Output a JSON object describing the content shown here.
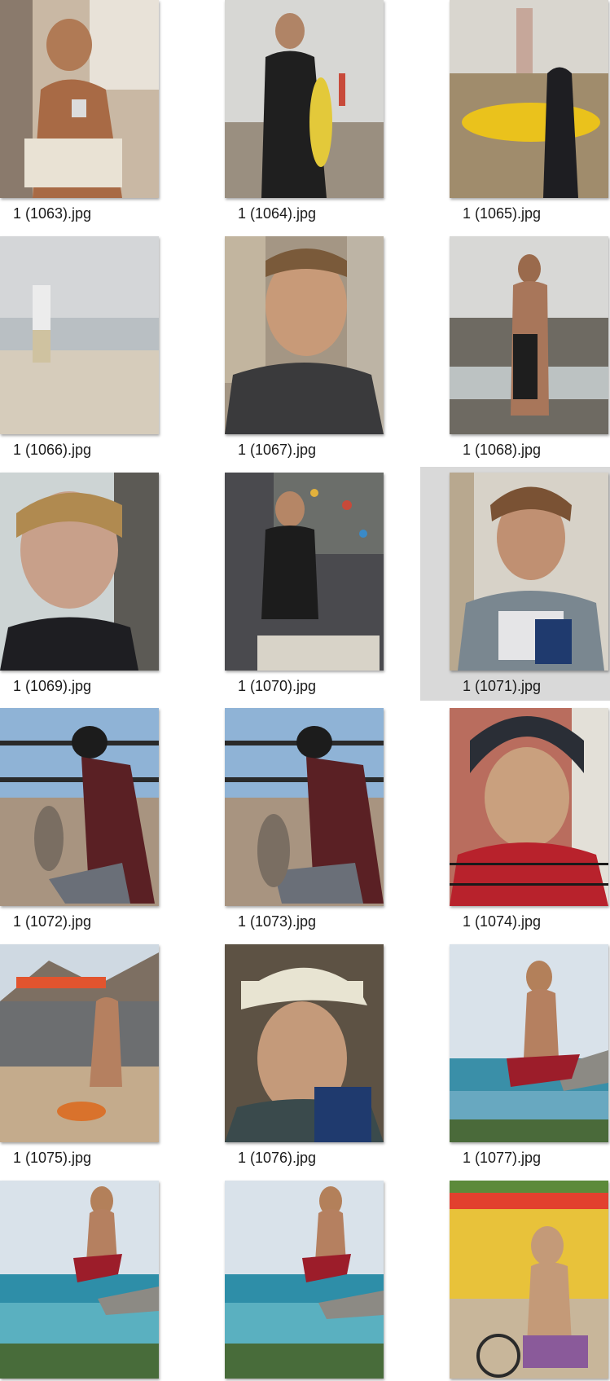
{
  "files": [
    {
      "name": "1 (1063).jpg",
      "icon": "photo-thumbnail-icon",
      "selected": false
    },
    {
      "name": "1 (1064).jpg",
      "icon": "photo-thumbnail-icon",
      "selected": false
    },
    {
      "name": "1 (1065).jpg",
      "icon": "photo-thumbnail-icon",
      "selected": false
    },
    {
      "name": "1 (1066).jpg",
      "icon": "photo-thumbnail-icon",
      "selected": false
    },
    {
      "name": "1 (1067).jpg",
      "icon": "photo-thumbnail-icon",
      "selected": false
    },
    {
      "name": "1 (1068).jpg",
      "icon": "photo-thumbnail-icon",
      "selected": false
    },
    {
      "name": "1 (1069).jpg",
      "icon": "photo-thumbnail-icon",
      "selected": false
    },
    {
      "name": "1 (1070).jpg",
      "icon": "photo-thumbnail-icon",
      "selected": false
    },
    {
      "name": "1 (1071).jpg",
      "icon": "photo-thumbnail-icon",
      "selected": true
    },
    {
      "name": "1 (1072).jpg",
      "icon": "photo-thumbnail-icon",
      "selected": false
    },
    {
      "name": "1 (1073).jpg",
      "icon": "photo-thumbnail-icon",
      "selected": false
    },
    {
      "name": "1 (1074).jpg",
      "icon": "photo-thumbnail-icon",
      "selected": false
    },
    {
      "name": "1 (1075).jpg",
      "icon": "photo-thumbnail-icon",
      "selected": false
    },
    {
      "name": "1 (1076).jpg",
      "icon": "photo-thumbnail-icon",
      "selected": false
    },
    {
      "name": "1 (1077).jpg",
      "icon": "photo-thumbnail-icon",
      "selected": false
    },
    {
      "name": "",
      "icon": "photo-thumbnail-icon",
      "selected": false
    },
    {
      "name": "",
      "icon": "photo-thumbnail-icon",
      "selected": false
    },
    {
      "name": "",
      "icon": "photo-thumbnail-icon",
      "selected": false
    }
  ],
  "colors": {
    "selection": "#d9d9d9",
    "caption_text": "#1a1a1a",
    "background": "#ffffff"
  }
}
